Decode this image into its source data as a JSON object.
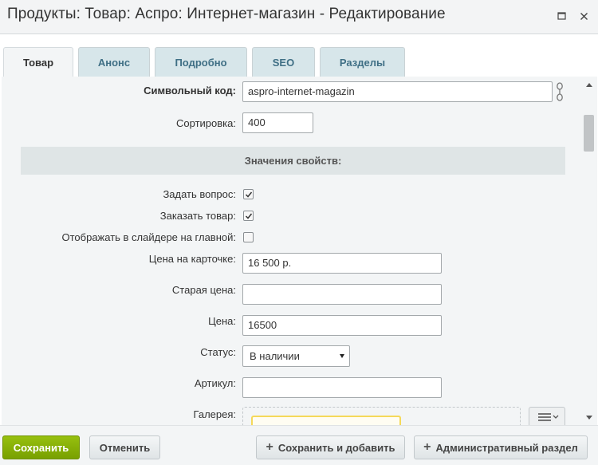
{
  "window": {
    "title": "Продукты: Товар: Аспро: Интернет-магазин - Редактирование",
    "maximize_icon": "maximize-icon",
    "close_icon": "close-icon"
  },
  "tabs": [
    {
      "label": "Товар",
      "active": true
    },
    {
      "label": "Анонс",
      "active": false
    },
    {
      "label": "Подробно",
      "active": false
    },
    {
      "label": "SEO",
      "active": false
    },
    {
      "label": "Разделы",
      "active": false
    }
  ],
  "form": {
    "symbolic_code": {
      "label": "Символьный код:",
      "value": "aspro-internet-magazin",
      "icon": "link-chain-icon"
    },
    "sort": {
      "label": "Сортировка:",
      "value": "400"
    },
    "properties_heading": "Значения свойств:",
    "ask_question": {
      "label": "Задать вопрос:",
      "checked": true
    },
    "order_product": {
      "label": "Заказать товар:",
      "checked": true
    },
    "show_in_slider": {
      "label": "Отображать в слайдере на главной:",
      "checked": false
    },
    "price_card": {
      "label": "Цена на карточке:",
      "value": "16 500 р."
    },
    "old_price": {
      "label": "Старая цена:",
      "value": ""
    },
    "price": {
      "label": "Цена:",
      "value": "16500"
    },
    "status": {
      "label": "Статус:",
      "value": "В наличии"
    },
    "article": {
      "label": "Артикул:",
      "value": ""
    },
    "gallery": {
      "label": "Галерея:",
      "menu_icon": "menu-lines-icon"
    }
  },
  "footer": {
    "save": "Сохранить",
    "cancel": "Отменить",
    "save_and_add": "Сохранить и добавить",
    "admin_section": "Административный раздел"
  },
  "colors": {
    "save_button": "#86ad00",
    "tab_inactive": "#d7e6ea",
    "tab_text": "#3f6f85",
    "content_bg": "#f3f5f6"
  }
}
